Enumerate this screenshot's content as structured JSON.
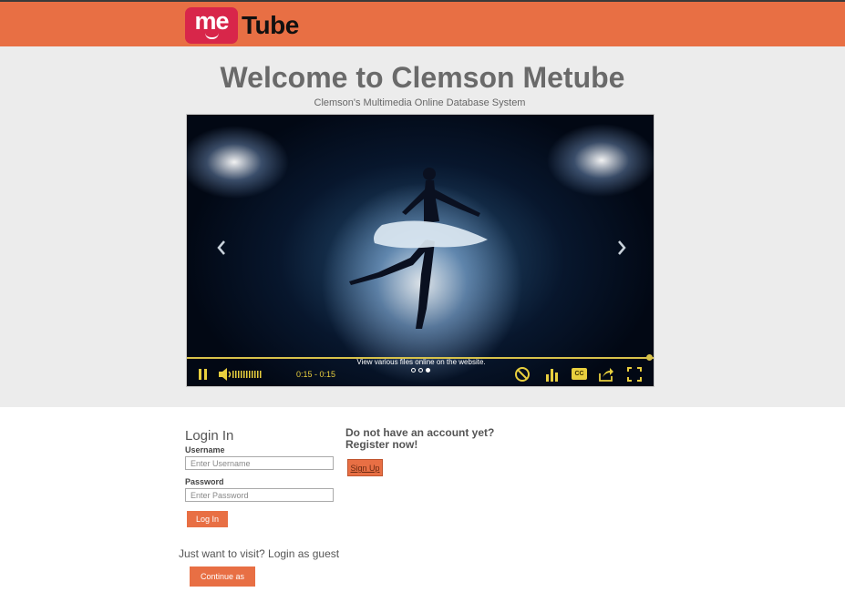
{
  "header": {
    "logo_me": "me",
    "logo_tube": "Tube",
    "brand_color": "#e86f44",
    "logo_badge_color": "#d8264a"
  },
  "hero": {
    "title": "Welcome to Clemson Metube",
    "subtitle": "Clemson's Multimedia Online Database System"
  },
  "carousel": {
    "prev_icon": "chevron-left-icon",
    "next_icon": "chevron-right-icon",
    "caption": "View various files online on the website.",
    "slide_count": 3,
    "active_slide": 3,
    "player": {
      "time": "0:15 - 0:15",
      "progress": 1.0,
      "accent_color": "#e8cf3e",
      "icons": [
        "pause-icon",
        "volume-icon",
        "block-icon",
        "stats-icon",
        "cc-icon",
        "share-icon",
        "fullscreen-icon"
      ],
      "cc_label": "CC"
    }
  },
  "login": {
    "title": "Login In",
    "username_label": "Username",
    "username_placeholder": "Enter Username",
    "username_value": "",
    "password_label": "Password",
    "password_placeholder": "Enter Password",
    "password_value": "",
    "submit_label": "Log In"
  },
  "register": {
    "line1": "Do not have an account yet?",
    "line2": "Register now!",
    "button_label": "Sign Up"
  },
  "guest": {
    "title": "Just want to visit? Login as guest",
    "button_label": "Continue as Guest"
  }
}
